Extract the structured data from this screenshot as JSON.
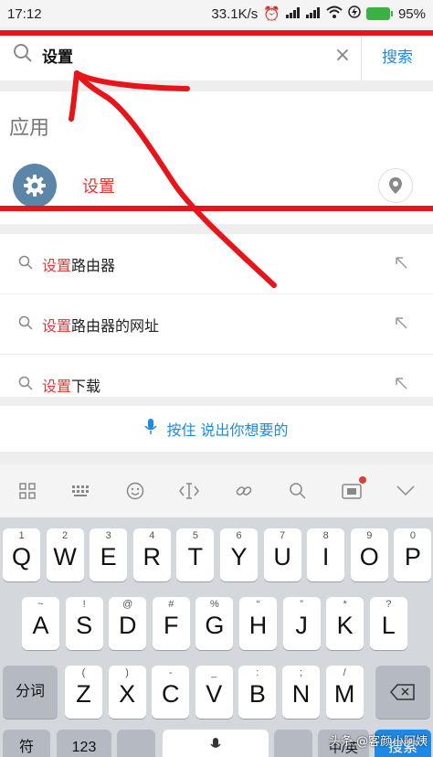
{
  "status_bar": {
    "time": "17:12",
    "speed": "33.1K/s",
    "battery": "95%"
  },
  "search": {
    "query": "设置",
    "button_label": "搜索",
    "clear_glyph": "×"
  },
  "apps_section": {
    "heading": "应用",
    "app_name": "设置"
  },
  "suggestions": [
    {
      "highlight": "设置",
      "rest": "路由器"
    },
    {
      "highlight": "设置",
      "rest": "路由器的网址"
    },
    {
      "highlight": "设置",
      "rest": "下载"
    }
  ],
  "voice": {
    "label": "按住 说出你想要的"
  },
  "keyboard": {
    "row1": [
      {
        "hint": "1",
        "key": "Q"
      },
      {
        "hint": "2",
        "key": "W"
      },
      {
        "hint": "3",
        "key": "E"
      },
      {
        "hint": "4",
        "key": "R"
      },
      {
        "hint": "5",
        "key": "T"
      },
      {
        "hint": "6",
        "key": "Y"
      },
      {
        "hint": "7",
        "key": "U"
      },
      {
        "hint": "8",
        "key": "I"
      },
      {
        "hint": "9",
        "key": "O"
      },
      {
        "hint": "0",
        "key": "P"
      }
    ],
    "row2": [
      {
        "hint": "~",
        "key": "A"
      },
      {
        "hint": "!",
        "key": "S"
      },
      {
        "hint": "@",
        "key": "D"
      },
      {
        "hint": "#",
        "key": "F"
      },
      {
        "hint": "%",
        "key": "G"
      },
      {
        "hint": "“",
        "key": "H"
      },
      {
        "hint": "”",
        "key": "J"
      },
      {
        "hint": "*",
        "key": "K"
      },
      {
        "hint": "?",
        "key": "L"
      }
    ],
    "row3": [
      {
        "hint": "(",
        "key": "Z"
      },
      {
        "hint": ")",
        "key": "X"
      },
      {
        "hint": "-",
        "key": "C"
      },
      {
        "hint": "_",
        "key": "V"
      },
      {
        "hint": ":",
        "key": "B"
      },
      {
        "hint": ";",
        "key": "N"
      },
      {
        "hint": "/",
        "key": "M"
      }
    ],
    "fenci_label": "分词",
    "symbol_label": "符",
    "num_label": "123",
    "lang_label": "中/英",
    "search_key_label": "搜索"
  },
  "watermark": "头条 @客颜小阿姨",
  "annotation_color": "#e8141a",
  "accent_color": "#1e88e5"
}
